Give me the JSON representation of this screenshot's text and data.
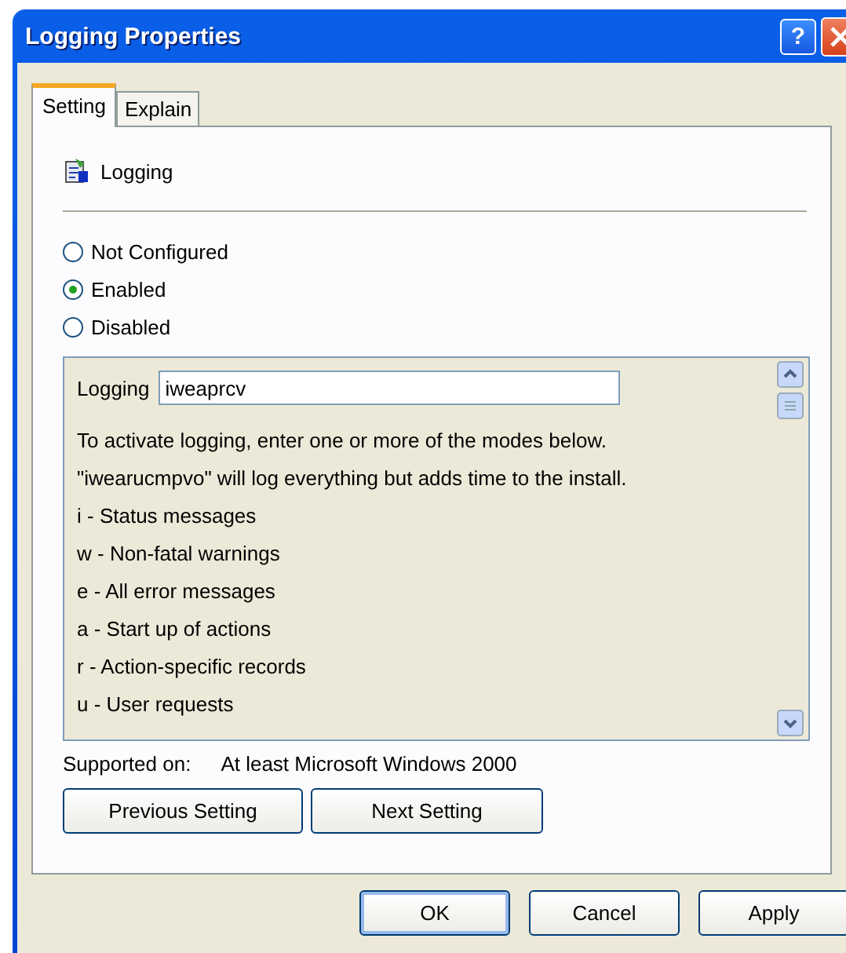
{
  "window": {
    "title": "Logging Properties",
    "help_button": "?"
  },
  "tabs": [
    {
      "label": "Setting",
      "selected": true
    },
    {
      "label": "Explain",
      "selected": false
    }
  ],
  "policy": {
    "name": "Logging"
  },
  "options": [
    {
      "label": "Not Configured",
      "selected": false
    },
    {
      "label": "Enabled",
      "selected": true
    },
    {
      "label": "Disabled",
      "selected": false
    }
  ],
  "options_box": {
    "field_label": "Logging",
    "field_value": "iweaprcv",
    "lines": [
      "To activate logging, enter one or more of the modes below.",
      "\"iwearucmpvo\" will log everything but adds time to the install.",
      "i - Status messages",
      "w - Non-fatal warnings",
      "e - All error messages",
      "a - Start up of actions",
      "r - Action-specific records",
      "u - User requests"
    ]
  },
  "supported": {
    "label": "Supported on:",
    "value": "At least Microsoft Windows 2000"
  },
  "nav_buttons": [
    "Previous Setting",
    "Next Setting"
  ],
  "buttons": [
    "OK",
    "Cancel",
    "Apply"
  ]
}
